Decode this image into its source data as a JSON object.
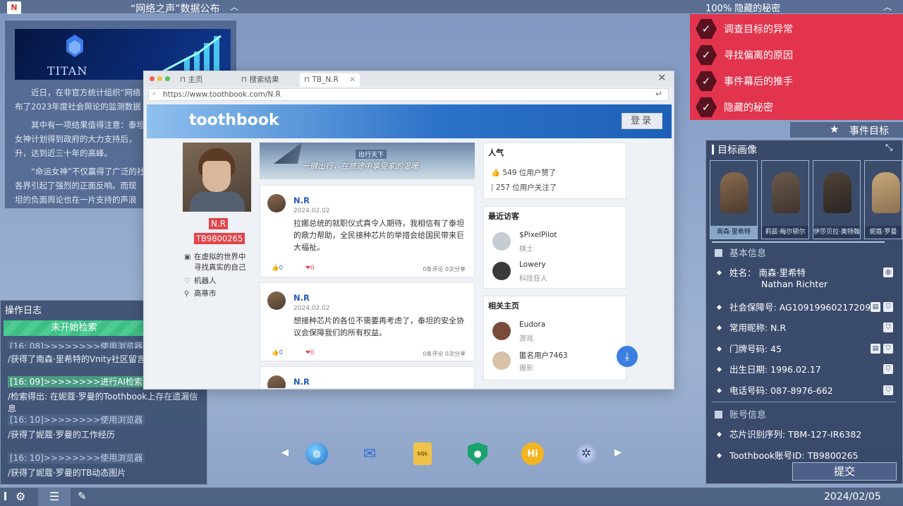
{
  "topbar": {
    "app_logo": "N",
    "news_title": "“网络之声”数据公布",
    "status": "100%  隐藏的秘密"
  },
  "news": {
    "banner_text": "TITAN",
    "paragraphs": [
      "近日，在非官方统计组织“网络",
      "布了2023年度社会舆论的监测数据",
      "其中有一项结果值得注意：泰坦",
      "女神计划得到政府的大力支持后，",
      "升，达到近三十年的高峰。",
      "“命运女神”不仅赢得了广泛的社",
      "各界引起了强烈的正面反响。而现",
      "坦的负面舆论也在一片支持的声浪"
    ]
  },
  "objectives": {
    "items": [
      {
        "label": "调查目标的异常",
        "done": true
      },
      {
        "label": "寻找偏离的原因",
        "done": true
      },
      {
        "label": "事件幕后的推手",
        "done": true
      },
      {
        "label": "隐藏的秘密",
        "done": true
      }
    ],
    "footer_label": "事件目标"
  },
  "target": {
    "title": "目标画像",
    "portraits": [
      {
        "name": "南森·里希特",
        "selected": true
      },
      {
        "name": "莉兹·梅尔顿尔",
        "selected": false
      },
      {
        "name": "伊莎贝拉·奥特翰",
        "selected": false
      },
      {
        "name": "妮蔻·罗曼",
        "selected": false
      }
    ],
    "basic_header": "基本信息",
    "name_label": "姓名：",
    "name_cn": "南森·里希特",
    "name_en": "Nathan Richter",
    "ssn": "社会保障号: AG10919960217209",
    "nickname": "常用昵称: N.R",
    "house": "门牌号码: 45",
    "birth": "出生日期: 1996.02.17",
    "phone": "电话号码: 087-8976-662",
    "account_header": "账号信息",
    "chip": "芯片识别序列: TBM-127-IR6382",
    "tb_id": "Toothbook账号ID: TB9800265",
    "submit": "提交"
  },
  "log": {
    "title": "操作日志",
    "status": "未开始检索",
    "entries": [
      {
        "time": "[16: 08]>>>>>>>>使用浏览器",
        "text": "/获得了南森·里希特的Vnity社区留言",
        "highlight": false
      },
      {
        "time": "[16: 09]>>>>>>>>进行AI检索",
        "text": "/检索得出: 在妮蔻·罗曼的Toothbook上存在遗漏信息",
        "highlight": true
      },
      {
        "time": "[16: 10]>>>>>>>>使用浏览器",
        "text": "/获得了妮蔻·罗曼的工作经历",
        "highlight": false
      },
      {
        "time": "[16: 10]>>>>>>>>使用浏览器",
        "text": "/获得了妮蔻·罗曼的TB动态图片",
        "highlight": false
      }
    ]
  },
  "bottombar": {
    "date": "2024/02/05"
  },
  "browser": {
    "tabs": [
      "主页",
      "搜索结果",
      "TB_N.R"
    ],
    "url": "https://www.toothbook.com/N.R",
    "site": {
      "logo": "toothbook",
      "login": "登录",
      "profile": {
        "name": "N.R",
        "id": "TB9800265",
        "bio": [
          "在虚拟的世界中",
          "寻找真实的自己"
        ],
        "type": "机器人",
        "city": "高蒂市"
      },
      "ad": {
        "badge": "出行天下",
        "text": "一键出行，在旅途中享受家的温暖"
      },
      "posts": [
        {
          "name": "N.R",
          "date": "2024.02.02",
          "text": "拉娜总统的就职仪式真令人期待，我相信有了泰坦的鼎力帮助，全民接种芯片的举措会给国民带来巨大福祉。",
          "likes": "0",
          "hearts": "0",
          "counts": "0条评论  0次分享"
        },
        {
          "name": "N.R",
          "date": "2024.02.02",
          "text": "想接种芯片的各位不需要再考虑了，泰坦的安全协议会保障我们的所有权益。",
          "likes": "0",
          "hearts": "0",
          "counts": "0条评论  0次分享"
        },
        {
          "name": "N.R"
        }
      ],
      "popular": {
        "title": "人气",
        "likes": "549  位用户赞了",
        "follows": "257  位用户关注了"
      },
      "visitors": {
        "title": "最近访客",
        "items": [
          {
            "name": "$PixelPilot",
            "sub": "棋士"
          },
          {
            "name": "Lowery",
            "sub": "科技狂人"
          }
        ]
      },
      "related": {
        "title": "相关主页",
        "items": [
          {
            "name": "Eudora",
            "sub": "游戏"
          },
          {
            "name": "匿名用户7463",
            "sub": "摄影"
          }
        ]
      }
    }
  },
  "dock": [
    "browser-globe-icon",
    "mail-icon",
    "sql-file-icon",
    "shield-key-icon",
    "hi-chat-icon",
    "spider-icon"
  ]
}
